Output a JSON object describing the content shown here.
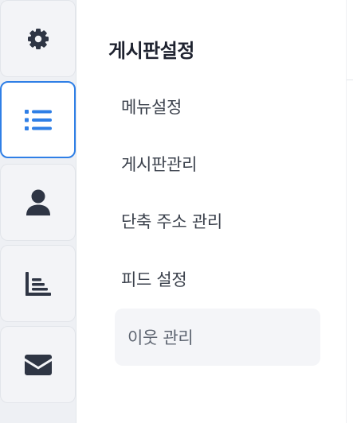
{
  "rail": {
    "items": [
      {
        "name": "settings",
        "icon": "gear-icon",
        "active": false
      },
      {
        "name": "board",
        "icon": "list-icon",
        "active": true
      },
      {
        "name": "user",
        "icon": "person-icon",
        "active": false
      },
      {
        "name": "stats",
        "icon": "chart-icon",
        "active": false
      },
      {
        "name": "mail",
        "icon": "envelope-icon",
        "active": false
      }
    ],
    "accent_color": "#2f7fe6",
    "icon_color": "#2e3544"
  },
  "panel": {
    "title": "게시판설정",
    "items": [
      {
        "label": "메뉴설정",
        "selected": false
      },
      {
        "label": "게시판관리",
        "selected": false
      },
      {
        "label": "단축 주소 관리",
        "selected": false
      },
      {
        "label": "피드 설정",
        "selected": false
      },
      {
        "label": "이웃 관리",
        "selected": true
      }
    ]
  }
}
